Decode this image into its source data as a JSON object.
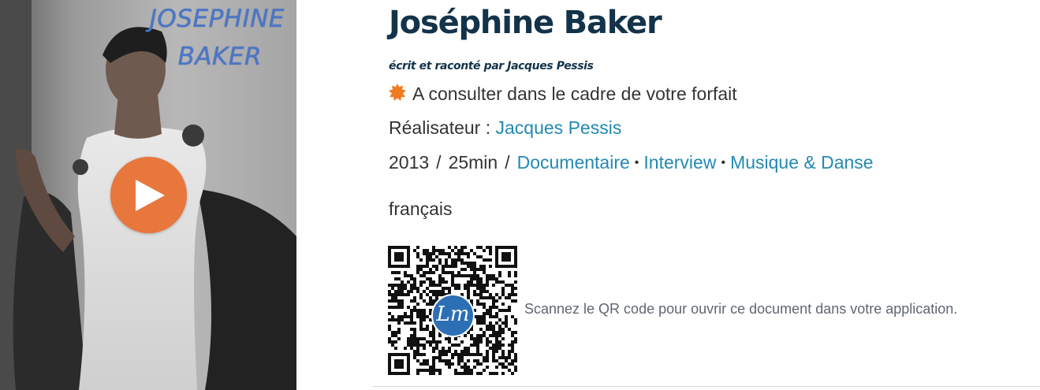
{
  "poster": {
    "title_line1": "JOSEPHINE",
    "title_line2": "BAKER",
    "play_icon": "play-icon"
  },
  "movie": {
    "title": "Joséphine Baker",
    "byline": "écrit et raconté par Jacques Pessis",
    "availability": "A consulter dans le cadre de votre forfait",
    "availability_icon": "orange-burst-icon",
    "director_label": "Réalisateur : ",
    "director": "Jacques Pessis",
    "year": "2013",
    "duration": "25min",
    "genres": [
      "Documentaire",
      "Interview",
      "Musique & Danse"
    ],
    "language": "français"
  },
  "qr": {
    "logo_text": "Lm",
    "caption": "Scannez le QR code pour ouvrir ce document dans votre application."
  },
  "colors": {
    "title": "#13334a",
    "link": "#2389b3",
    "play": "#e8773d",
    "badge": "#f07a1f",
    "qr_logo": "#2d6fb4"
  }
}
